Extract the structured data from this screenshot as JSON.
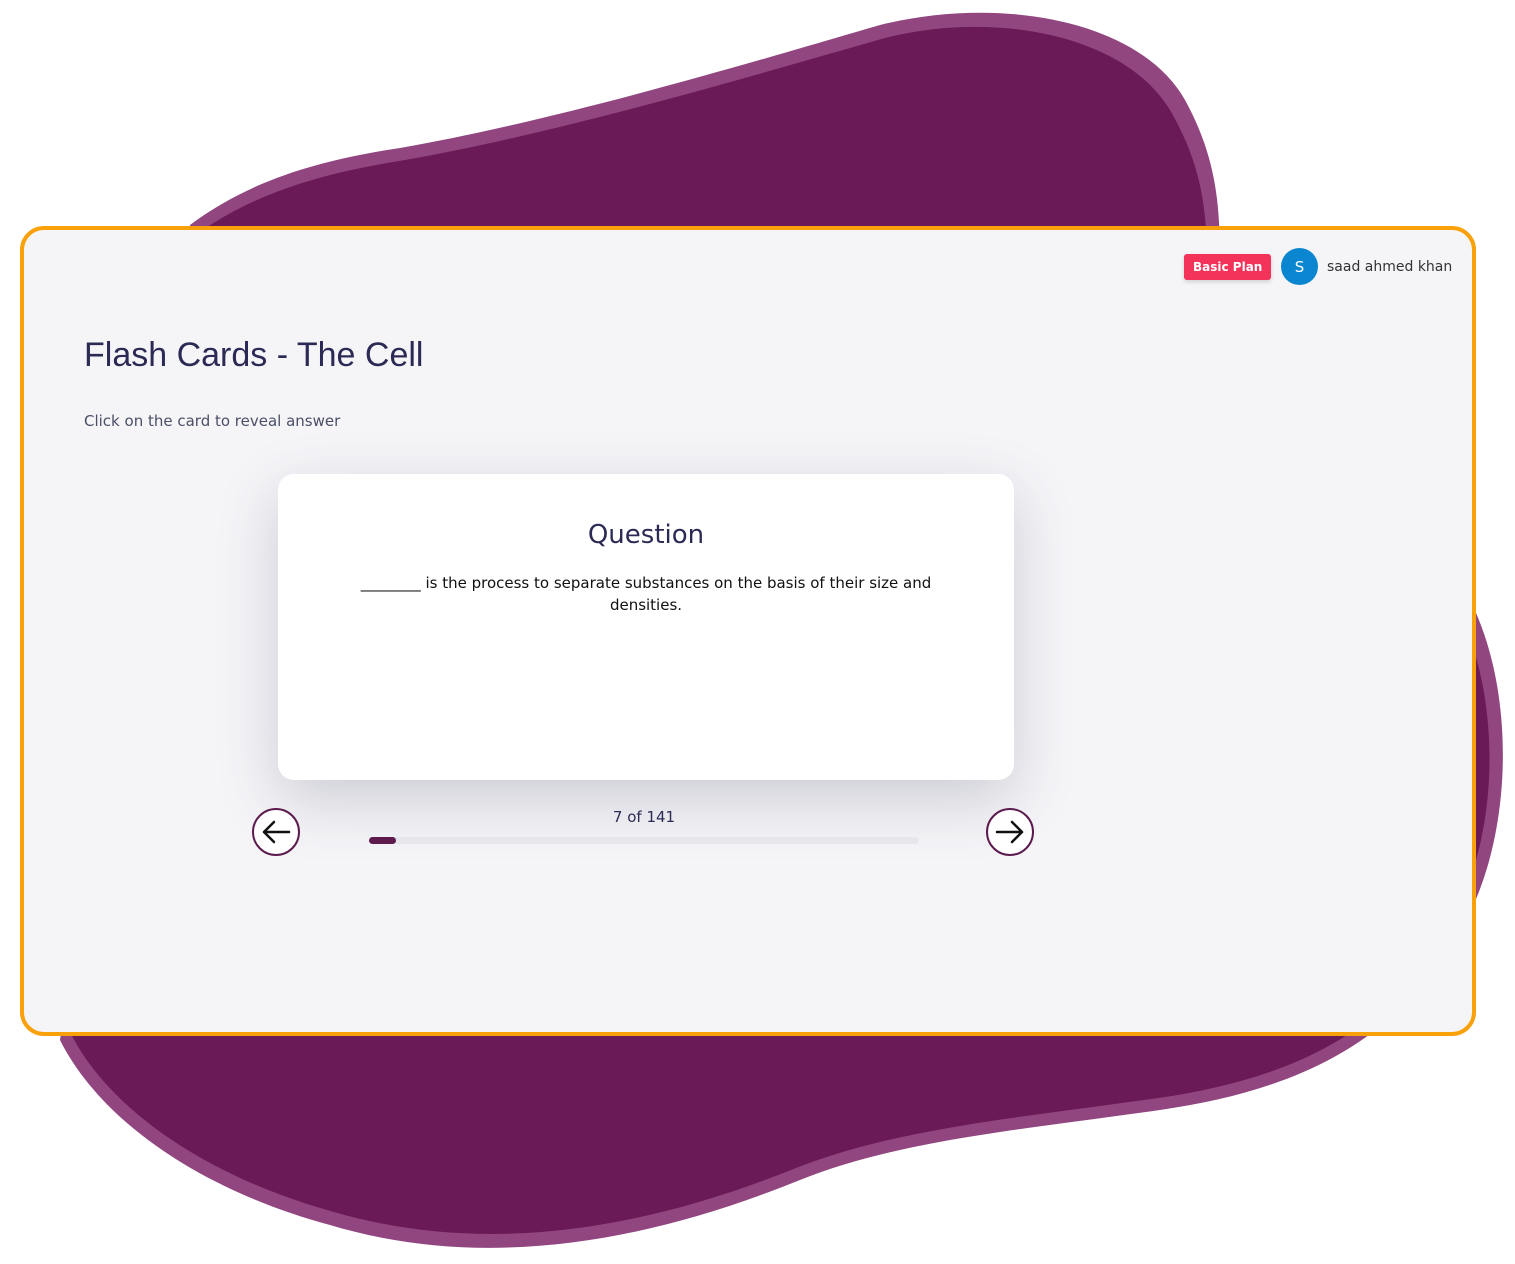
{
  "colors": {
    "accent": "#5c1a4d",
    "blob": "#6a1a56",
    "blob_edge": "#92467f",
    "frame": "#f8a10b",
    "badge": "#f3335a",
    "avatar": "#0a86d0"
  },
  "header": {
    "plan_badge": "Basic Plan",
    "avatar_initial": "S",
    "user_name": "saad ahmed khan"
  },
  "page": {
    "title": "Flash Cards - The Cell",
    "hint": "Click on the card to reveal answer"
  },
  "card": {
    "heading": "Question",
    "text": "________ is the process to separate substances on the basis of their size and densities."
  },
  "progress": {
    "label": "7 of 141",
    "current": 7,
    "total": 141,
    "percent": 4.96
  },
  "icons": {
    "prev": "arrow-left-icon",
    "next": "arrow-right-icon"
  }
}
